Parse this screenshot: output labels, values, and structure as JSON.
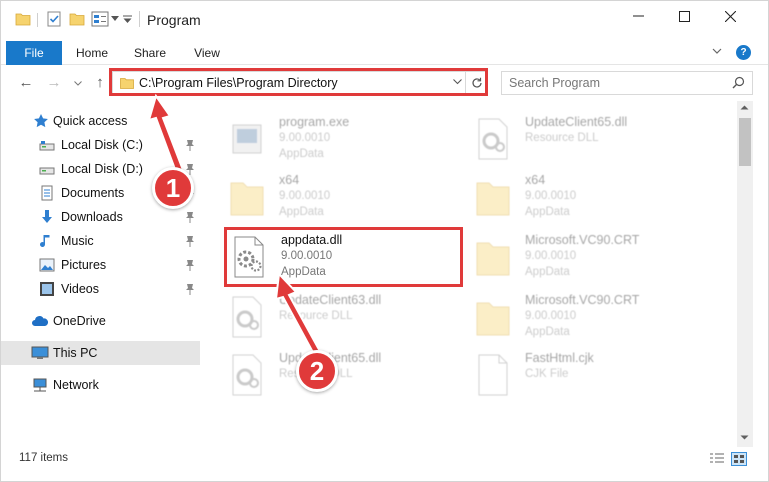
{
  "window": {
    "title": "Program",
    "quick_access_icons": [
      "folder-icon",
      "checkmark-icon",
      "folder-icon",
      "properties-icon",
      "dropdown-icon"
    ],
    "controls": {
      "minimize": "—",
      "maximize": "☐",
      "close": "✕"
    }
  },
  "ribbon": {
    "tabs": [
      {
        "label": "File"
      },
      {
        "label": "Home"
      },
      {
        "label": "Share"
      },
      {
        "label": "View"
      }
    ],
    "accent_color": "#1979ca"
  },
  "nav": {
    "back": "←",
    "forward": "→",
    "up": "↑",
    "address_path": "C:\\Program Files\\Program Directory",
    "search_placeholder": "Search Program"
  },
  "sidebar": {
    "items": [
      {
        "label": "Quick access",
        "icon": "star-icon",
        "pinned": false
      },
      {
        "label": "Local Disk (C:)",
        "icon": "drive-icon",
        "pinned": true
      },
      {
        "label": "Local Disk (D:)",
        "icon": "drive-icon",
        "pinned": true
      },
      {
        "label": "Documents",
        "icon": "documents-icon",
        "pinned": true
      },
      {
        "label": "Downloads",
        "icon": "download-icon",
        "pinned": true
      },
      {
        "label": "Music",
        "icon": "music-icon",
        "pinned": true
      },
      {
        "label": "Pictures",
        "icon": "pictures-icon",
        "pinned": true
      },
      {
        "label": "Videos",
        "icon": "videos-icon",
        "pinned": true
      },
      {
        "label": "OneDrive",
        "icon": "cloud-icon",
        "pinned": false
      },
      {
        "label": "This PC",
        "icon": "computer-icon",
        "pinned": false,
        "selected": true
      },
      {
        "label": "Network",
        "icon": "network-icon",
        "pinned": false
      }
    ]
  },
  "files": [
    {
      "name": "program.exe",
      "line1": "9.00.0010",
      "line2": "AppData",
      "icon": "exe-icon",
      "highlighted": false
    },
    {
      "name": "UpdateClient65.dll",
      "line1": "Resource DLL",
      "line2": "",
      "icon": "dll-icon",
      "highlighted": false
    },
    {
      "name": "x64",
      "line1": "9.00.0010",
      "line2": "AppData",
      "icon": "folder-icon",
      "highlighted": false
    },
    {
      "name": "x64",
      "line1": "9.00.0010",
      "line2": "AppData",
      "icon": "folder-icon",
      "highlighted": false
    },
    {
      "name": "appdata.dll",
      "line1": "9.00.0010",
      "line2": "AppData",
      "icon": "dll-icon",
      "highlighted": true
    },
    {
      "name": "Microsoft.VC90.CRT",
      "line1": "9.00.0010",
      "line2": "AppData",
      "icon": "folder-icon",
      "highlighted": false
    },
    {
      "name": "UpdateClient63.dll",
      "line1": "Resource DLL",
      "line2": "",
      "icon": "dll-icon",
      "highlighted": false
    },
    {
      "name": "Microsoft.VC90.CRT",
      "line1": "9.00.0010",
      "line2": "AppData",
      "icon": "folder-icon",
      "highlighted": false
    },
    {
      "name": "UpdateClient65.dll",
      "line1": "Resource DLL",
      "line2": "",
      "icon": "dll-icon",
      "highlighted": false
    },
    {
      "name": "FastHtml.cjk",
      "line1": "CJK File",
      "line2": "",
      "icon": "file-icon",
      "highlighted": false
    }
  ],
  "status": {
    "item_count": "117 items"
  },
  "annotations": {
    "color": "#e03a3a",
    "step1": "1",
    "step2": "2"
  }
}
